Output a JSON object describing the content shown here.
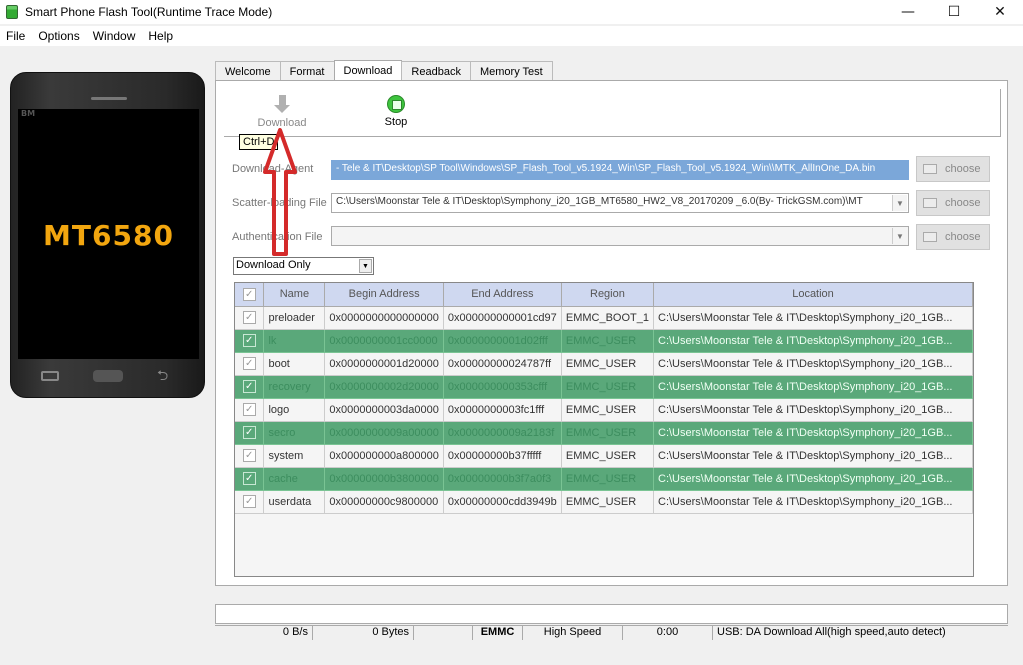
{
  "window": {
    "title": "Smart Phone Flash Tool(Runtime Trace Mode)",
    "min": "—",
    "max": "☐",
    "close": "✕"
  },
  "menu": [
    "File",
    "Options",
    "Window",
    "Help"
  ],
  "phone": {
    "brand": "BM",
    "model": "MT6580"
  },
  "tabs": [
    "Welcome",
    "Format",
    "Download",
    "Readback",
    "Memory Test"
  ],
  "active_tab": "Download",
  "toolbar": {
    "download": "Download",
    "stop": "Stop",
    "tooltip": "Ctrl+D"
  },
  "fields": {
    "da_label": "Download-Agent",
    "da_value": "- Tele & IT\\Desktop\\SP Tool\\Windows\\SP_Flash_Tool_v5.1924_Win\\SP_Flash_Tool_v5.1924_Win\\\\MTK_AllInOne_DA.bin",
    "scatter_label": "Scatter-loading File",
    "scatter_value": "C:\\Users\\Moonstar Tele & IT\\Desktop\\Symphony_i20_1GB_MT6580_HW2_V8_20170209 _6.0(By- TrickGSM.com)\\MT",
    "auth_label": "Authentication File",
    "auth_value": "",
    "choose": "choose"
  },
  "mode": "Download Only",
  "table": {
    "headers": [
      "Name",
      "Begin Address",
      "End Address",
      "Region",
      "Location"
    ],
    "rows": [
      {
        "name": "preloader",
        "begin": "0x0000000000000000",
        "end": "0x000000000001cd97",
        "region": "EMMC_BOOT_1",
        "loc": "C:\\Users\\Moonstar Tele & IT\\Desktop\\Symphony_i20_1GB...",
        "hl": false
      },
      {
        "name": "lk",
        "begin": "0x0000000001cc0000",
        "end": "0x0000000001d02fff",
        "region": "EMMC_USER",
        "loc": "C:\\Users\\Moonstar Tele & IT\\Desktop\\Symphony_i20_1GB...",
        "hl": true
      },
      {
        "name": "boot",
        "begin": "0x0000000001d20000",
        "end": "0x00000000024787ff",
        "region": "EMMC_USER",
        "loc": "C:\\Users\\Moonstar Tele & IT\\Desktop\\Symphony_i20_1GB...",
        "hl": false
      },
      {
        "name": "recovery",
        "begin": "0x0000000002d20000",
        "end": "0x000000000353cfff",
        "region": "EMMC_USER",
        "loc": "C:\\Users\\Moonstar Tele & IT\\Desktop\\Symphony_i20_1GB...",
        "hl": true
      },
      {
        "name": "logo",
        "begin": "0x0000000003da0000",
        "end": "0x0000000003fc1fff",
        "region": "EMMC_USER",
        "loc": "C:\\Users\\Moonstar Tele & IT\\Desktop\\Symphony_i20_1GB...",
        "hl": false
      },
      {
        "name": "secro",
        "begin": "0x0000000009a00000",
        "end": "0x0000000009a2183f",
        "region": "EMMC_USER",
        "loc": "C:\\Users\\Moonstar Tele & IT\\Desktop\\Symphony_i20_1GB...",
        "hl": true
      },
      {
        "name": "system",
        "begin": "0x000000000a800000",
        "end": "0x00000000b37fffff",
        "region": "EMMC_USER",
        "loc": "C:\\Users\\Moonstar Tele & IT\\Desktop\\Symphony_i20_1GB...",
        "hl": false
      },
      {
        "name": "cache",
        "begin": "0x00000000b3800000",
        "end": "0x00000000b3f7a0f3",
        "region": "EMMC_USER",
        "loc": "C:\\Users\\Moonstar Tele & IT\\Desktop\\Symphony_i20_1GB...",
        "hl": true
      },
      {
        "name": "userdata",
        "begin": "0x00000000c9800000",
        "end": "0x00000000cdd3949b",
        "region": "EMMC_USER",
        "loc": "C:\\Users\\Moonstar Tele & IT\\Desktop\\Symphony_i20_1GB...",
        "hl": false
      }
    ]
  },
  "status": {
    "speed": "0 B/s",
    "bytes": "0 Bytes",
    "storage": "EMMC",
    "mode": "High Speed",
    "time": "0:00",
    "usb": "USB: DA Download All(high speed,auto detect)"
  },
  "colors": {
    "row_highlight": "#5aa87a",
    "annotation": "#d42a2a",
    "header_bg": "#cfd8f0"
  }
}
